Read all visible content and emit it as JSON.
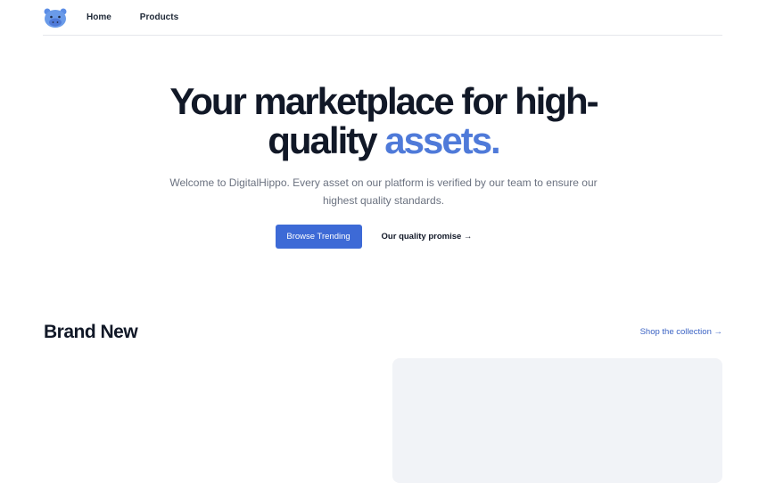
{
  "nav": {
    "logo_icon": "hippo-logo-icon",
    "home_label": "Home",
    "products_label": "Products"
  },
  "hero": {
    "title_main": "Your marketplace for high-quality",
    "title_accent": "assets.",
    "description": "Welcome to DigitalHippo. Every asset on our platform is verified by our team to ensure our highest quality standards.",
    "primary_button": "Browse Trending",
    "secondary_button": "Our quality promise →"
  },
  "brand_new": {
    "title": "Brand New",
    "shop_link": "Shop the collection →"
  },
  "colors": {
    "accent": "#4f7ad9",
    "button": "#3d6ad6",
    "card": "#f1f3f7"
  }
}
